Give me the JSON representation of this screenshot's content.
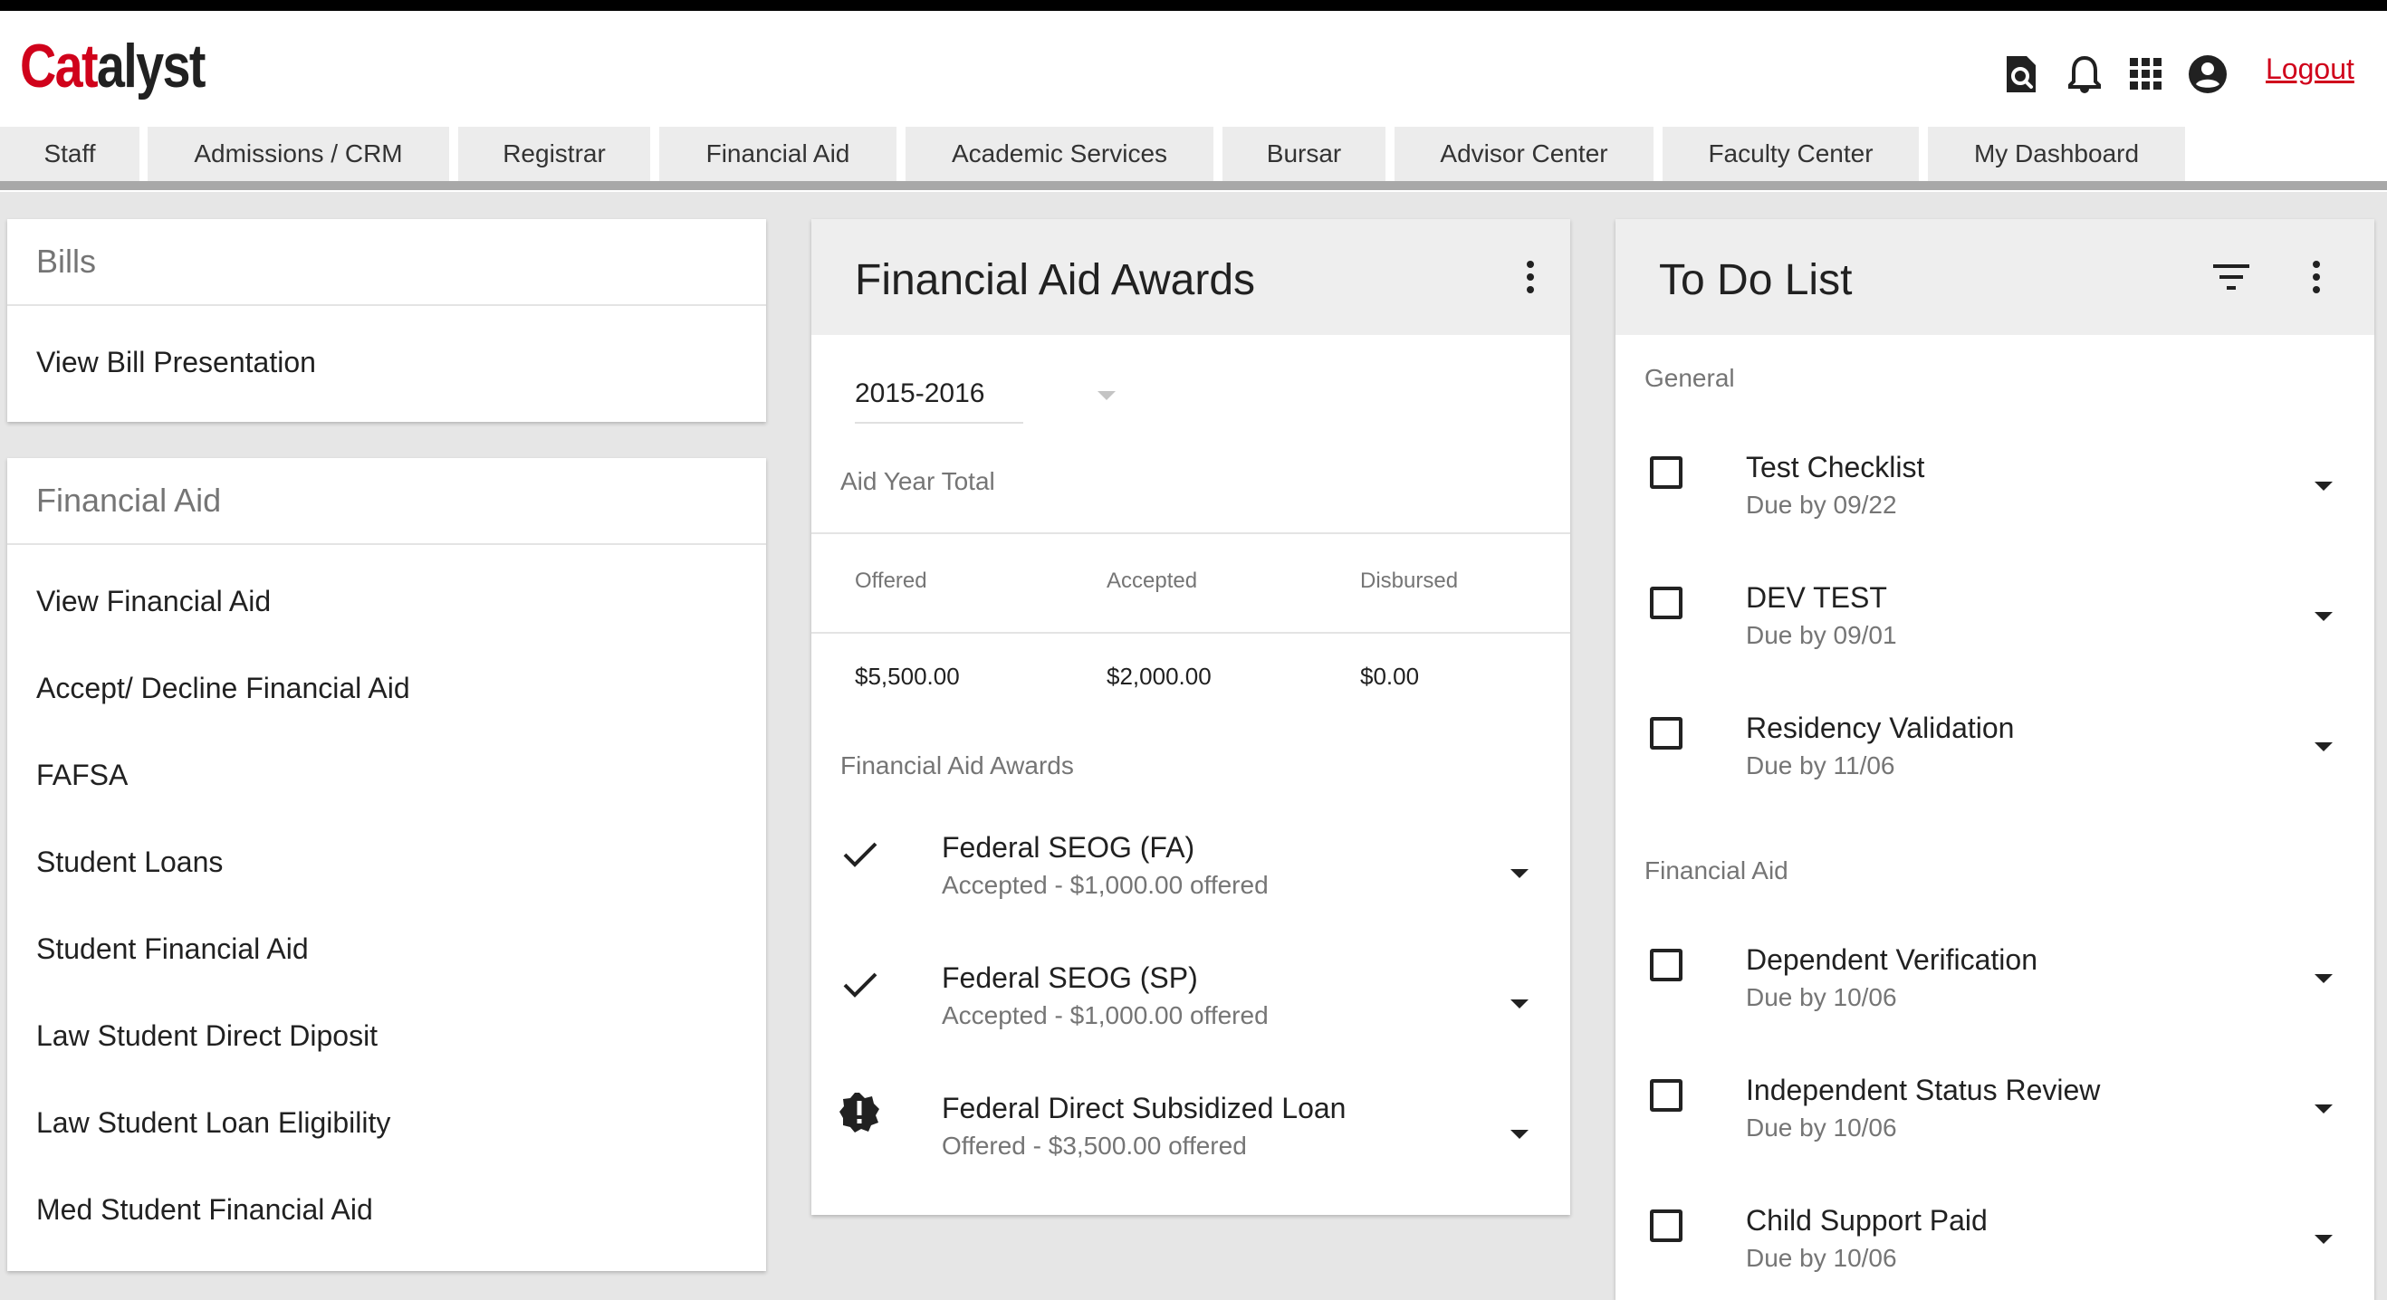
{
  "app": {
    "logo_left": "Cat",
    "logo_right": "alyst",
    "accent_color": "#d0021b"
  },
  "header": {
    "icons": [
      "search-icon",
      "bell-icon",
      "apps-grid-icon",
      "account-icon"
    ],
    "logout_label": "Logout"
  },
  "nav": {
    "tabs": [
      {
        "label": "Staff"
      },
      {
        "label": "Admissions / CRM"
      },
      {
        "label": "Registrar"
      },
      {
        "label": "Financial Aid"
      },
      {
        "label": "Academic Services"
      },
      {
        "label": "Bursar"
      },
      {
        "label": "Advisor Center"
      },
      {
        "label": "Faculty Center"
      },
      {
        "label": "My Dashboard"
      }
    ]
  },
  "bills": {
    "title": "Bills",
    "links": [
      "View Bill Presentation"
    ]
  },
  "financial_aid": {
    "title": "Financial Aid",
    "links": [
      "View Financial Aid",
      "Accept/ Decline Financial Aid",
      "FAFSA",
      "Student Loans",
      "Student Financial Aid",
      "Law Student Direct Diposit",
      "Law Student Loan Eligibility",
      "Med Student Financial Aid"
    ]
  },
  "awards": {
    "title": "Financial Aid Awards",
    "year_select": "2015-2016",
    "aid_year_total_label": "Aid Year Total",
    "columns": [
      "Offered",
      "Accepted",
      "Disbursed"
    ],
    "totals": [
      "$5,500.00",
      "$2,000.00",
      "$0.00"
    ],
    "section_label": "Financial Aid Awards",
    "items": [
      {
        "name": "Federal SEOG (FA)",
        "status": "Accepted - $1,000.00 offered",
        "icon": "check-icon"
      },
      {
        "name": "Federal SEOG (SP)",
        "status": "Accepted - $1,000.00 offered",
        "icon": "check-icon"
      },
      {
        "name": "Federal Direct Subsidized Loan",
        "status": "Offered - $3,500.00 offered",
        "icon": "alert-badge-icon"
      }
    ]
  },
  "todo": {
    "title": "To Do List",
    "groups": [
      {
        "label": "General",
        "items": [
          {
            "name": "Test Checklist",
            "due": "Due by 09/22"
          },
          {
            "name": "DEV TEST",
            "due": "Due by 09/01"
          },
          {
            "name": "Residency Validation",
            "due": "Due by 11/06"
          }
        ]
      },
      {
        "label": "Financial Aid",
        "items": [
          {
            "name": "Dependent Verification",
            "due": "Due by 10/06"
          },
          {
            "name": "Independent Status Review",
            "due": "Due by 10/06"
          },
          {
            "name": "Child Support Paid",
            "due": "Due by 10/06"
          }
        ]
      }
    ]
  }
}
